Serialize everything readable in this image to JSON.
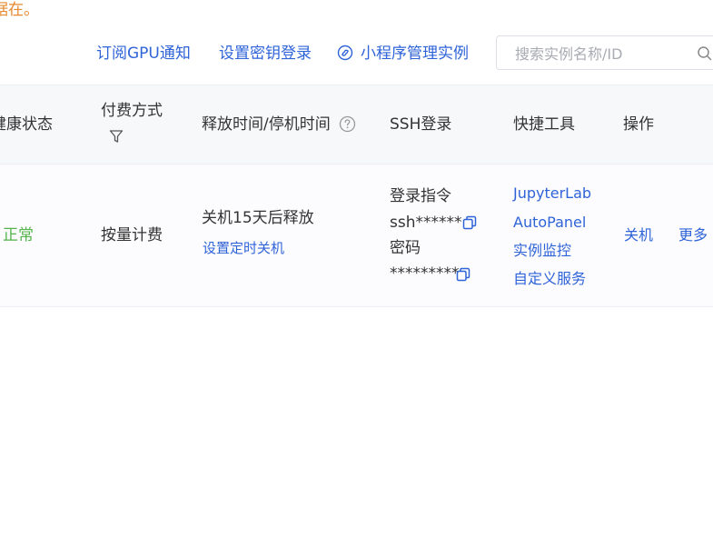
{
  "notice": {
    "text": "据在。"
  },
  "toolbar": {
    "subscribe_gpu": "订阅GPU通知",
    "set_key_login": "设置密钥登录",
    "miniprogram": "小程序管理实例"
  },
  "search": {
    "placeholder": "搜索实例名称/ID"
  },
  "table": {
    "headers": {
      "health": "健康状态",
      "billing": "付费方式",
      "release_time": "释放时间/停机时间",
      "ssh": "SSH登录",
      "tools": "快捷工具",
      "actions": "操作"
    },
    "row": {
      "health": "正常",
      "billing": "按量计费",
      "release": "关机15天后释放",
      "set_timer": "设置定时关机",
      "login_cmd_label": "登录指令",
      "login_cmd_value": "ssh******",
      "password_label": "密码",
      "password_value": "*********",
      "tools": [
        "JupyterLab",
        "AutoPanel",
        "实例监控",
        "自定义服务"
      ],
      "shutdown": "关机",
      "more": "更多"
    }
  },
  "colors": {
    "link": "#2f63d8",
    "success": "#52b34b",
    "warning": "#e6892e",
    "header_bg": "#f7f8fa"
  }
}
